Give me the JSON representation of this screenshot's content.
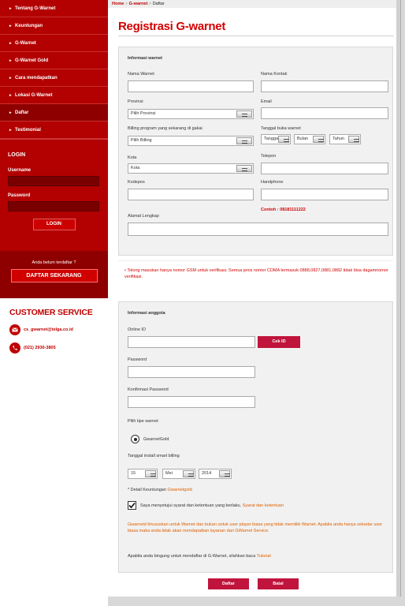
{
  "sidebar": {
    "nav": [
      {
        "label": "Tentang G-Warnet",
        "active": false
      },
      {
        "label": "Keuntungan",
        "active": false
      },
      {
        "label": "G-Warnet",
        "active": false
      },
      {
        "label": "G-Warnet Gold",
        "active": false
      },
      {
        "label": "Cara mendapatkan",
        "active": false
      },
      {
        "label": "Lokasi G-Warnet",
        "active": false
      },
      {
        "label": "Daftar",
        "active": true
      },
      {
        "label": "Testimonial",
        "active": false
      }
    ],
    "login": {
      "title": "LOGIN",
      "username_label": "Username",
      "password_label": "Password",
      "button": "LOGIN"
    },
    "register": {
      "question": "Anda belum terdaftar ?",
      "button": "DAFTAR SEKARANG"
    },
    "customer_service": {
      "title": "CUSTOMER SERVICE",
      "email": "cs_gwarnet@telga.co.id",
      "phone": "(021) 2930-3805"
    }
  },
  "breadcrumb": {
    "home": "Home",
    "sep1": " > ",
    "gwarnet": "G-warnet",
    "sep2": " > ",
    "current": "Daftar"
  },
  "title": "Registrasi G-warnet",
  "warnet_info": {
    "heading": "Informasi warnet",
    "nama_warnet_label": "Nama Warnet",
    "nama_kontak_label": "Nama Kontak",
    "provinsi_label": "Provinsi",
    "provinsi_value": "Pilih Provinsi",
    "email_label": "Email",
    "billing_label": "Billing program yang sekarang di gakai",
    "billing_value": "Pilih Billing",
    "tanggal_buka_label": "Tanggal buka warnet",
    "tgl_value": "Tanggal",
    "bulan_value": "Bulan",
    "tahun_value": "Tahun",
    "kota_label": "Kota",
    "kota_value": "Kota",
    "telepon_label": "Telepon",
    "kodepos_label": "Kodepos",
    "handphone_label": "Handphone",
    "handphone_example": "Contoh : 08181111222",
    "alamat_label": "Alamat Lengkap"
  },
  "notice": "Tolong masukan hanya nomor GSM untuk verifikasi. Semua jenis nomor CDMA termasuk 0888,0827,0881,0882 tidak bisa dagamnomor verifikasi.",
  "anggota_info": {
    "heading": "Informasi anggota",
    "online_id_label": "Online ID",
    "cek_id_button": "Cek ID",
    "password_label": "Password",
    "konfirmasi_label": "Konfirmasi Password",
    "tipe_label": "Pilih tipe warnet",
    "tipe_value": "GwarnetGold",
    "install_label": "Tanggal install smart billing",
    "install_tgl": "15",
    "install_bln": "Mei",
    "install_thn": "2014",
    "detail_prefix": "* Detail Keuntungan ",
    "detail_link": "Gwarnetgold",
    "agree_text": "Saya menyetujui syarat dan ketentuan yang berlaku. ",
    "agree_link": "Syarat dan ketentuan",
    "orange_note": "Gwarnetd khususkan untuk Warnet dan bukan untuk user player biasa yang tidak memiliki Warnet. Apabila anda hanya sekedar user biasa maka anda tidak akan mendapatkan layanan dari GWarnet Service.",
    "help_prefix": "Apabila anda bingung untuk mendaftar di G-Warnet, silahkan baca ",
    "help_link": "Tutorial"
  },
  "actions": {
    "submit": "Daftar",
    "reset": "Batal"
  },
  "colors": {
    "brand_red": "#b30000",
    "title_red": "#d40000",
    "button_crimson": "#c0143c",
    "link_orange": "#e06000"
  }
}
